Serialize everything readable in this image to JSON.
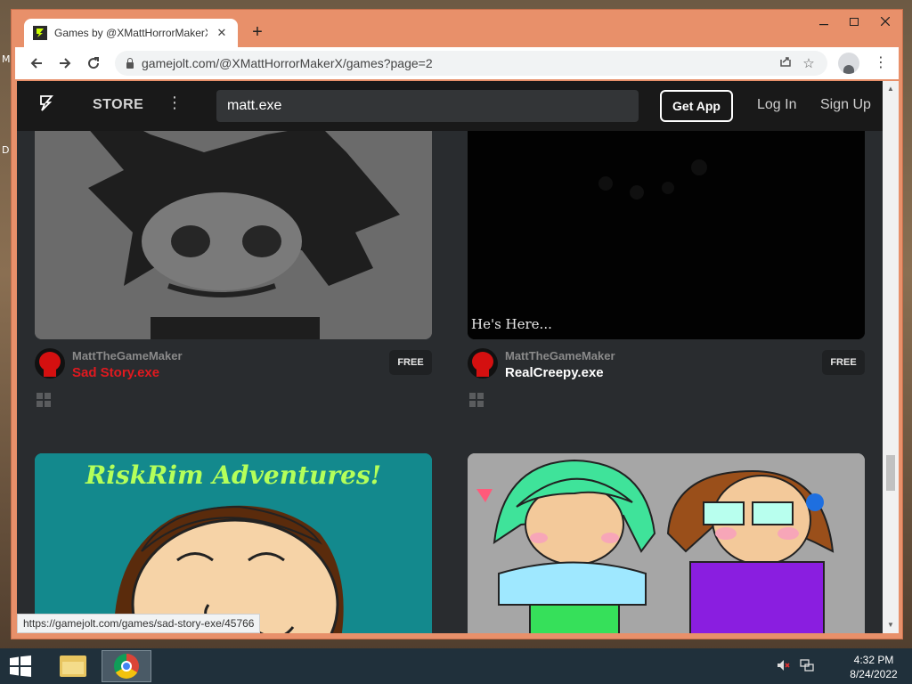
{
  "browser": {
    "tab_title": "Games by @XMattHorrorMakerX",
    "tab_close": "✕",
    "new_tab": "+",
    "url": "gamejolt.com/@XMattHorrorMakerX/games?page=2",
    "status_url": "https://gamejolt.com/games/sad-story-exe/45766",
    "icons": [
      "back-icon",
      "forward-icon",
      "reload-icon",
      "lock-icon",
      "share-icon",
      "star-icon",
      "profile-icon",
      "menu-icon"
    ]
  },
  "site": {
    "store_label": "STORE",
    "search_value": "matt.exe",
    "get_app_label": "Get App",
    "login_label": "Log In",
    "signup_label": "Sign Up"
  },
  "games": [
    {
      "developer": "MattTheGameMaker",
      "title": "Sad Story.exe",
      "title_color": "#e0191f",
      "price": "FREE",
      "thumb_caption": ""
    },
    {
      "developer": "MattTheGameMaker",
      "title": "RealCreepy.exe",
      "title_color": "#ffffff",
      "price": "FREE",
      "thumb_caption": "He's Here..."
    },
    {
      "developer": "",
      "title": "",
      "price": "",
      "thumb_caption": "RiskRim Adventures!"
    },
    {
      "developer": "",
      "title": "",
      "price": "",
      "thumb_caption": ""
    }
  ],
  "taskbar": {
    "time": "4:32 PM",
    "date": "8/24/2022"
  },
  "colors": {
    "window_frame": "#e8906a",
    "page_bg": "#292c2f",
    "header_bg": "#191919"
  }
}
